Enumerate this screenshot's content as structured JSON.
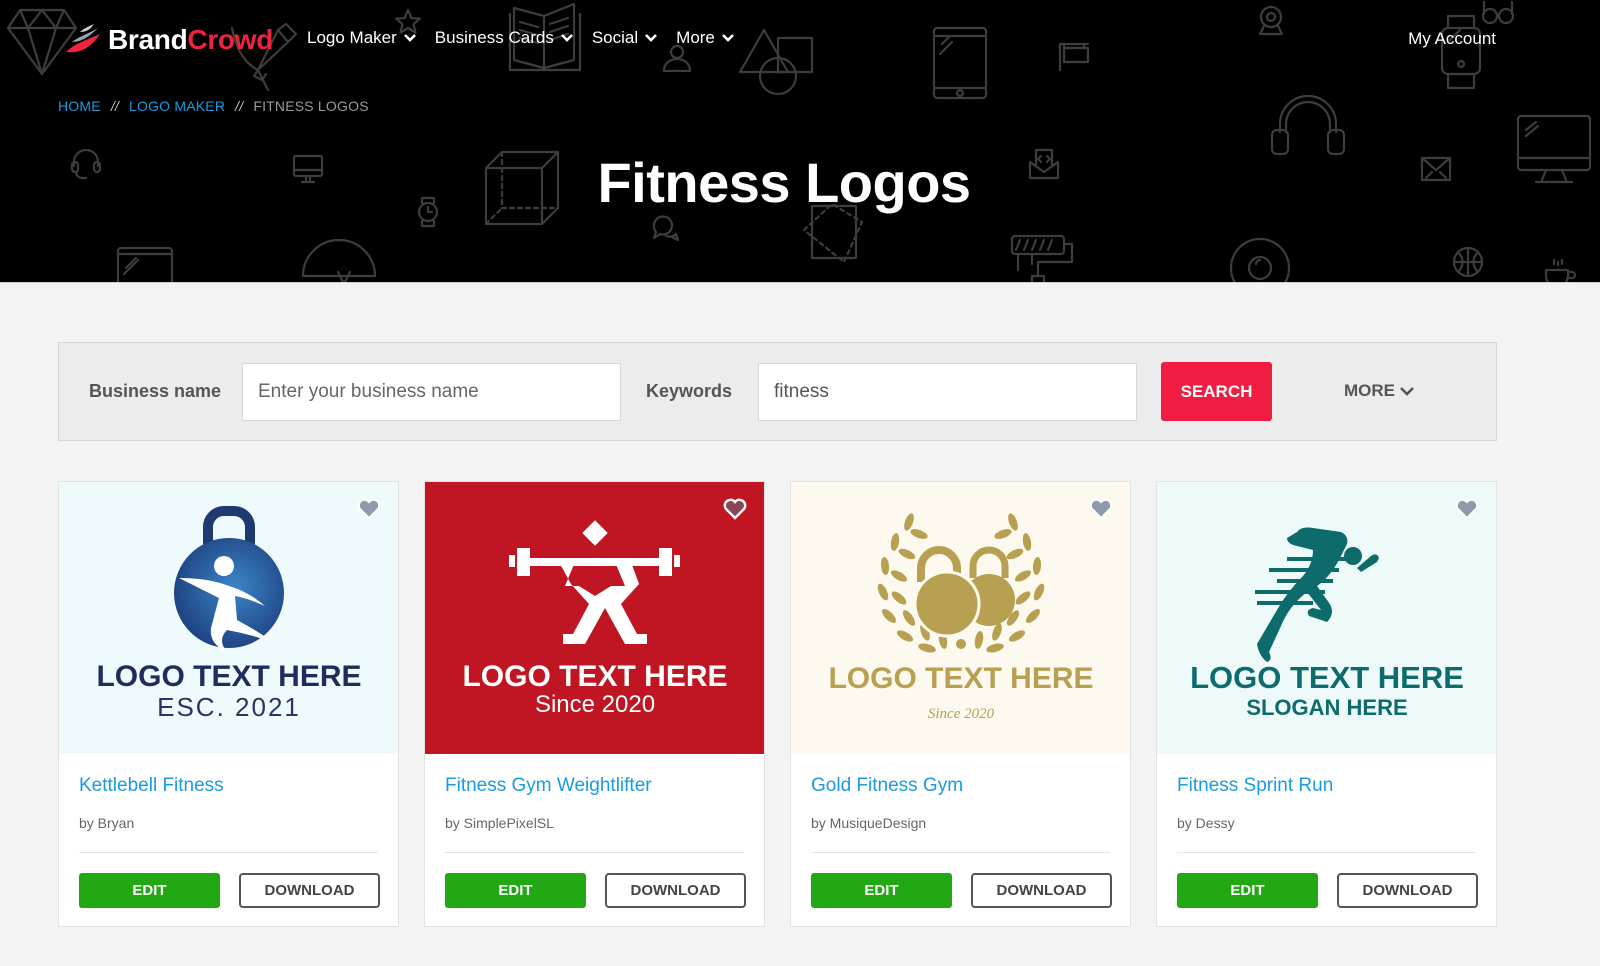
{
  "brand": {
    "part1": "Brand",
    "part2": "Crowd"
  },
  "nav": {
    "items": [
      {
        "label": "Logo Maker"
      },
      {
        "label": "Business Cards"
      },
      {
        "label": "Social"
      },
      {
        "label": "More"
      }
    ],
    "account": "My Account"
  },
  "breadcrumb": {
    "items": [
      "HOME",
      "LOGO MAKER",
      "FITNESS LOGOS"
    ],
    "separator": "//"
  },
  "page": {
    "title": "Fitness Logos"
  },
  "search": {
    "business_label": "Business name",
    "business_placeholder": "Enter your business name",
    "business_value": "",
    "keywords_label": "Keywords",
    "keywords_value": "fitness",
    "search_button": "SEARCH",
    "more_button": "MORE"
  },
  "colors": {
    "brand_red": "#ee2340",
    "search_red": "#f01c41",
    "link_blue": "#1a9be0",
    "edit_green": "#22a813"
  },
  "cards": [
    {
      "title": "Kettlebell Fitness",
      "author": "by Bryan",
      "logo_line1": "LOGO TEXT HERE",
      "logo_line2": "ESC. 2021",
      "icon": "kettlebell-figure-icon",
      "favorited": false,
      "edit": "EDIT",
      "download": "DOWNLOAD"
    },
    {
      "title": "Fitness Gym Weightlifter",
      "author": "by SimplePixelSL",
      "logo_line1": "LOGO TEXT HERE",
      "logo_line2": "Since 2020",
      "icon": "weightlifter-icon",
      "favorited": false,
      "edit": "EDIT",
      "download": "DOWNLOAD"
    },
    {
      "title": "Gold Fitness Gym",
      "author": "by MusiqueDesign",
      "logo_line1": "LOGO TEXT HERE",
      "logo_line2": "Since 2020",
      "icon": "laurel-kettlebells-icon",
      "favorited": false,
      "edit": "EDIT",
      "download": "DOWNLOAD"
    },
    {
      "title": "Fitness Sprint Run",
      "author": "by Dessy",
      "logo_line1": "LOGO TEXT HERE",
      "logo_line2": "SLOGAN HERE",
      "icon": "sprinter-icon",
      "favorited": false,
      "edit": "EDIT",
      "download": "DOWNLOAD"
    }
  ]
}
